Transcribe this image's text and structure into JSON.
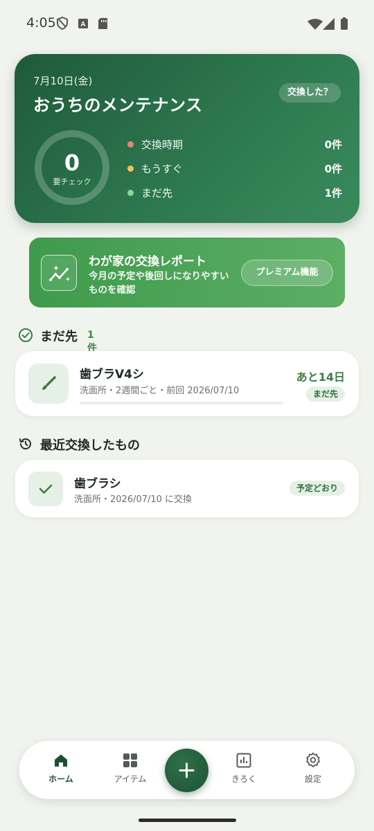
{
  "status_bar": {
    "time": "4:05",
    "icons": [
      "shield-icon",
      "keyboard-a-icon",
      "sim-card-icon",
      "wifi-icon",
      "signal-icon",
      "battery-icon"
    ]
  },
  "hero": {
    "date": "7月10日(金)",
    "title": "おうちのメンテナンス",
    "replace_button": "交換した？",
    "ring_count": "0",
    "ring_label": "要チェック",
    "legend": [
      {
        "label": "交換時期",
        "count": "0件",
        "color": "#e8877a"
      },
      {
        "label": "もうすぐ",
        "count": "0件",
        "color": "#f0c35a"
      },
      {
        "label": "まだ先",
        "count": "1件",
        "color": "#8fd498"
      }
    ]
  },
  "premium": {
    "title": "わが家の交換レポート",
    "description": "今月の予定や後回しになりやすいものを確認",
    "button": "プレミアム機能",
    "icon": "sparkle-chart-icon"
  },
  "sections": {
    "upcoming": {
      "title": "まだ先",
      "count": "1件",
      "icon": "check-circle-icon"
    },
    "recent": {
      "title": "最近交換したもの",
      "icon": "history-icon"
    }
  },
  "upcoming_items": [
    {
      "name": "歯ブラV4シ",
      "meta": "洗面所・2週間ごと・前回 2026/07/10",
      "days_left": "あと14日",
      "status": "まだ先",
      "progress": 0.0,
      "icon": "brush-icon"
    }
  ],
  "recent_items": [
    {
      "name": "歯ブラシ",
      "meta": "洗面所・2026/07/10 に交換",
      "status": "予定どおり",
      "icon": "check-icon"
    }
  ],
  "nav": {
    "items": [
      {
        "label": "ホーム",
        "icon": "home-icon",
        "active": true
      },
      {
        "label": "アイテム",
        "icon": "grid-icon",
        "active": false
      },
      {
        "label": "きろく",
        "icon": "chart-icon",
        "active": false
      },
      {
        "label": "設定",
        "icon": "gear-icon",
        "active": false
      }
    ],
    "fab_icon": "plus-icon"
  },
  "colors": {
    "hero_dark": "#1f5a3a",
    "accent_green": "#3d7d45",
    "background": "#f1f3ee"
  }
}
